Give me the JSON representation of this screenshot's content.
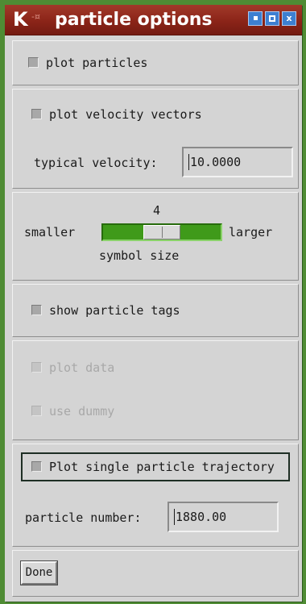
{
  "window": {
    "icon_letter": "K",
    "pin_glyph": "-¤",
    "title": "particle options",
    "title_bar_color": "#8b2418",
    "buttons": {
      "minimize_icon": "minimize-icon",
      "maximize_icon": "maximize-icon",
      "close_label": "x"
    }
  },
  "plot_particles": {
    "label": "plot particles",
    "checked": false
  },
  "velocity": {
    "label": "plot velocity vectors",
    "checked": false,
    "typical_label": "typical velocity:",
    "typical_value": "10.0000"
  },
  "symbol_size": {
    "value_text": "4",
    "value": 4,
    "smaller_label": "smaller",
    "larger_label": "larger",
    "caption": "symbol size",
    "trough_color": "#3f9a1a"
  },
  "tags": {
    "label": "show particle tags",
    "checked": false
  },
  "disabled_group": {
    "plot_data_label": "plot data",
    "use_dummy_label": "use dummy"
  },
  "trajectory": {
    "label": "Plot single particle trajectory",
    "checked": false,
    "particle_number_label": "particle number:",
    "particle_number_value": "1880.00"
  },
  "footer": {
    "done_label": "Done"
  }
}
